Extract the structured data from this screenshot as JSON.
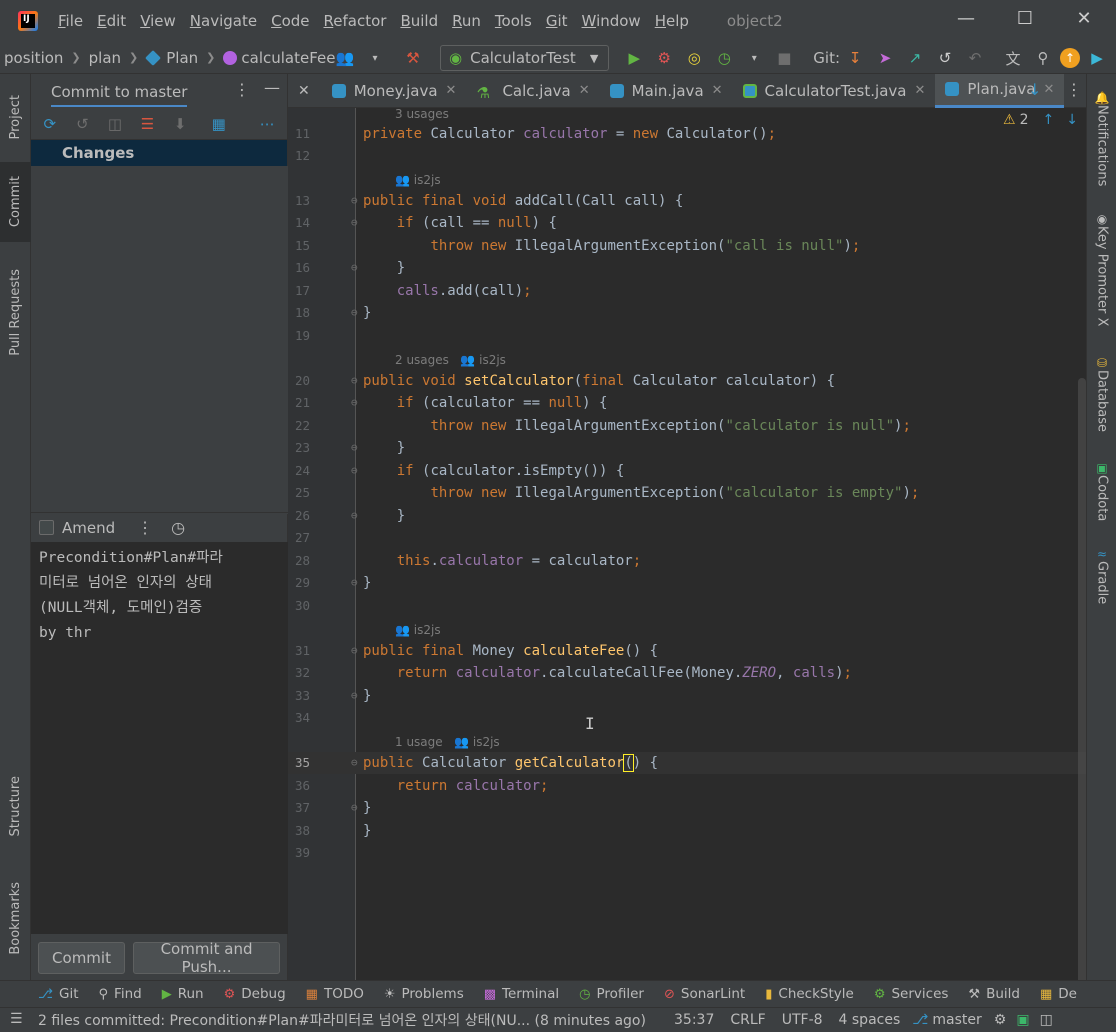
{
  "menubar": {
    "items": [
      "File",
      "Edit",
      "View",
      "Navigate",
      "Code",
      "Refactor",
      "Build",
      "Run",
      "Tools",
      "Git",
      "Window",
      "Help"
    ],
    "project_name": "object2",
    "logo_letter": "IJ"
  },
  "navbar": {
    "breadcrumbs": [
      "position",
      "plan",
      "Plan",
      "calculateFee"
    ],
    "run_config": "CalculatorTest",
    "git_label": "Git:"
  },
  "left_strip": {
    "project": "Project",
    "commit": "Commit",
    "pull_requests": "Pull Requests",
    "structure": "Structure",
    "bookmarks": "Bookmarks"
  },
  "commit_panel": {
    "title": "Commit to master",
    "changes_label": "Changes",
    "amend_label": "Amend",
    "message": "Precondition#Plan#파라\n미터로 넘어온 인자의 상태\n(NULL객체, 도메인)검증 \nby thr",
    "commit_button": "Commit",
    "commit_push_button": "Commit and Push..."
  },
  "editor": {
    "tabs": [
      {
        "label": "Money.java",
        "kind": "class"
      },
      {
        "label": "Calc.java",
        "kind": "calc"
      },
      {
        "label": "Main.java",
        "kind": "class"
      },
      {
        "label": "CalculatorTest.java",
        "kind": "test"
      },
      {
        "label": "Plan.java",
        "kind": "class",
        "active": true
      }
    ],
    "warning_count": "2",
    "hints": {
      "h1": "3 usages",
      "h2": "is2js",
      "h3a": "2 usages",
      "h3b": "is2js",
      "h4": "is2js",
      "h5a": "1 usage",
      "h5b": "is2js"
    },
    "line_numbers": [
      "11",
      "12",
      "13",
      "14",
      "15",
      "16",
      "17",
      "18",
      "19",
      "20",
      "21",
      "22",
      "23",
      "24",
      "25",
      "26",
      "27",
      "28",
      "29",
      "30",
      "31",
      "32",
      "33",
      "34",
      "35",
      "36",
      "37",
      "38",
      "39"
    ],
    "current_line": "35"
  },
  "right_strip": {
    "notifications": "Notifications",
    "key_promoter": "Key Promoter X",
    "database": "Database",
    "codota": "Codota",
    "gradle": "Gradle"
  },
  "bottom_tools": [
    "Git",
    "Find",
    "Run",
    "Debug",
    "TODO",
    "Problems",
    "Terminal",
    "Profiler",
    "SonarLint",
    "CheckStyle",
    "Services",
    "Build",
    "De"
  ],
  "statusbar": {
    "message": "2 files committed: Precondition#Plan#파라미터로 넘어온 인자의 상태(NU... (8 minutes ago)",
    "position": "35:37",
    "line_sep": "CRLF",
    "encoding": "UTF-8",
    "indent": "4 spaces",
    "branch": "master"
  },
  "colors": {
    "accent": "#4a88c7",
    "keyword": "#cc7832",
    "string": "#6a8759",
    "field": "#9876aa",
    "method": "#ffc66d",
    "run_green": "#62b543"
  }
}
